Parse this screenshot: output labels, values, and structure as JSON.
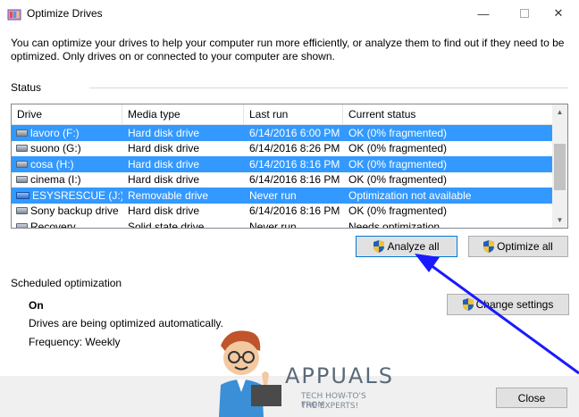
{
  "window": {
    "title": "Optimize Drives",
    "minimize_glyph": "—",
    "close_glyph": "✕"
  },
  "intro_text": "You can optimize your drives to help your computer run more efficiently, or analyze them to find out if they need to be optimized. Only drives on or connected to your computer are shown.",
  "status": {
    "label": "Status",
    "columns": [
      "Drive",
      "Media type",
      "Last run",
      "Current status"
    ],
    "rows": [
      {
        "drive": "lavoro (F:)",
        "media": "Hard disk drive",
        "last_run": "6/14/2016 6:00 PM",
        "status": "OK (0% fragmented)",
        "selected": true,
        "icon": "hard-drive-icon"
      },
      {
        "drive": "suono (G:)",
        "media": "Hard disk drive",
        "last_run": "6/14/2016 8:26 PM",
        "status": "OK (0% fragmented)",
        "selected": false,
        "icon": "hard-drive-icon"
      },
      {
        "drive": "cosa (H:)",
        "media": "Hard disk drive",
        "last_run": "6/14/2016 8:16 PM",
        "status": "OK (0% fragmented)",
        "selected": true,
        "icon": "hard-drive-icon"
      },
      {
        "drive": "cinema (I:)",
        "media": "Hard disk drive",
        "last_run": "6/14/2016 8:16 PM",
        "status": "OK (0% fragmented)",
        "selected": false,
        "icon": "hard-drive-icon"
      },
      {
        "drive": "ESYSRESCUE (J:)",
        "media": "Removable drive",
        "last_run": "Never run",
        "status": "Optimization not available",
        "selected": true,
        "icon": "usb-drive-icon"
      },
      {
        "drive": "Sony backup drive ...",
        "media": "Hard disk drive",
        "last_run": "6/14/2016 8:16 PM",
        "status": "OK (0% fragmented)",
        "selected": false,
        "icon": "hard-drive-icon"
      },
      {
        "drive": "Recovery",
        "media": "Solid state drive",
        "last_run": "Never run",
        "status": "Needs optimization",
        "selected": false,
        "icon": "hard-drive-icon"
      }
    ]
  },
  "buttons": {
    "analyze_all": "Analyze all",
    "optimize_all": "Optimize all",
    "change_settings": "Change settings",
    "close": "Close"
  },
  "scheduled": {
    "label": "Scheduled optimization",
    "state": "On",
    "description": "Drives are being optimized automatically.",
    "frequency": "Frequency: Weekly"
  },
  "watermark": {
    "brand": "APPUALS",
    "tagline_1": "TECH HOW-TO'S FROM",
    "tagline_2": "THE EXPERTS!"
  },
  "colors": {
    "selection": "#3399ff",
    "annotation_arrow": "#1a1aff",
    "footer_bg": "#f0f0f0"
  }
}
